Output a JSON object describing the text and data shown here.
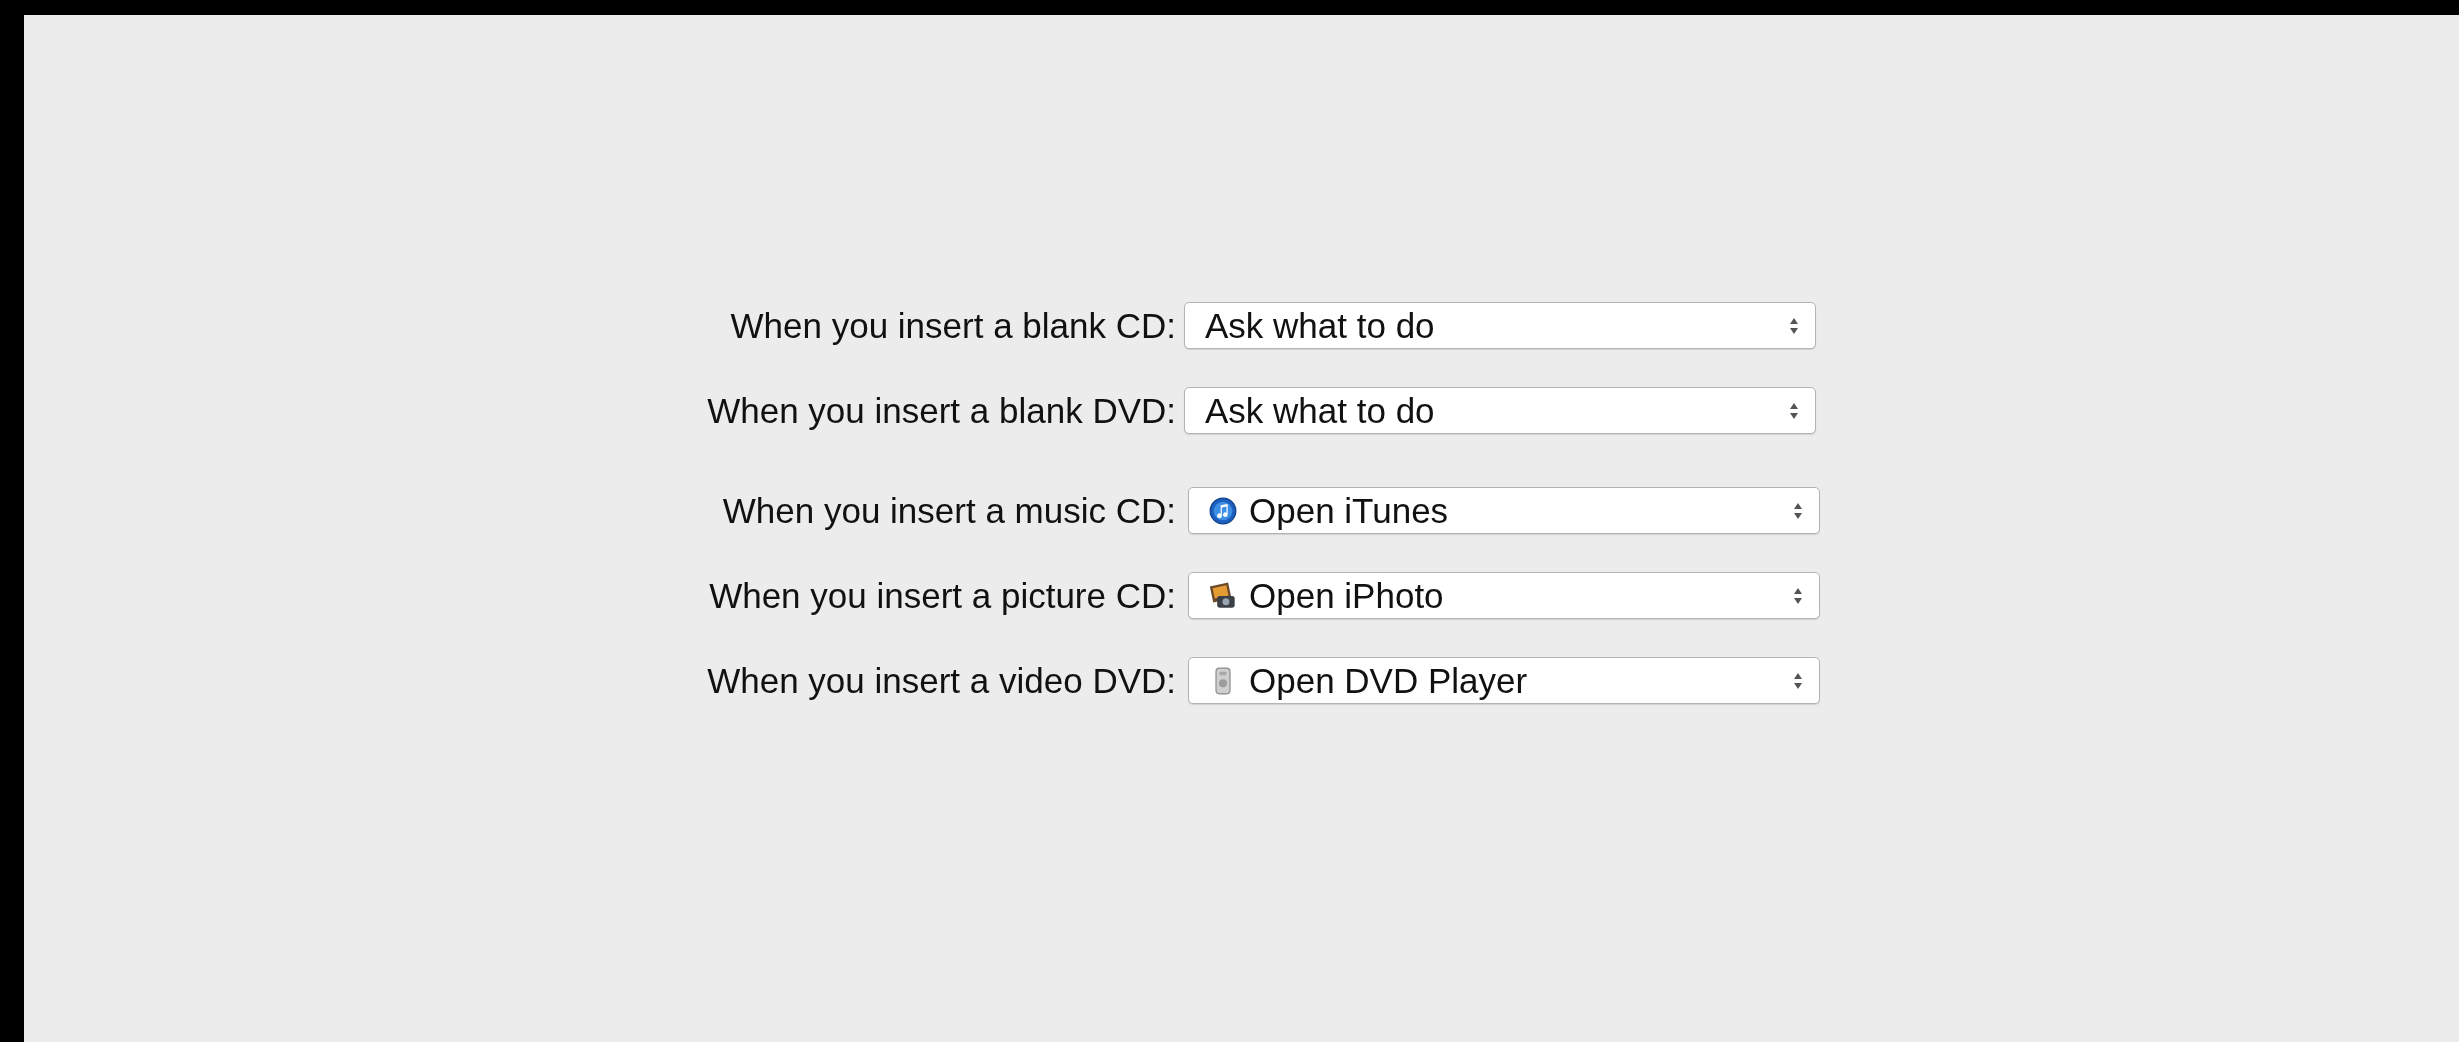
{
  "groups": [
    {
      "rows": [
        {
          "label": "When you insert a blank CD:",
          "value": "Ask what to do",
          "kind": "plain"
        },
        {
          "label": "When you insert a blank DVD:",
          "value": "Ask what to do",
          "kind": "plain"
        }
      ]
    },
    {
      "rows": [
        {
          "label": "When you insert a music CD:",
          "value": "Open iTunes",
          "kind": "music"
        },
        {
          "label": "When you insert a picture CD:",
          "value": "Open iPhoto",
          "kind": "photo"
        },
        {
          "label": "When you insert a video DVD:",
          "value": "Open DVD Player",
          "kind": "player"
        }
      ]
    }
  ]
}
